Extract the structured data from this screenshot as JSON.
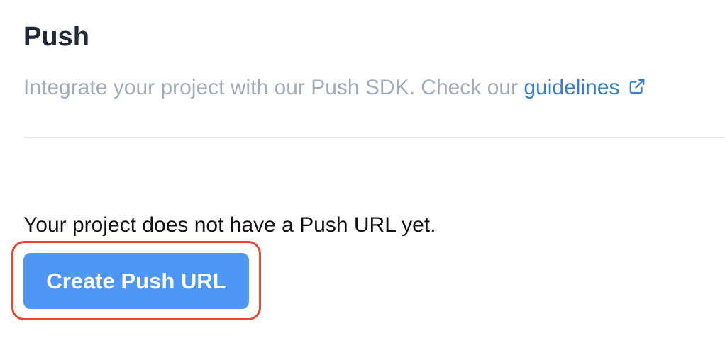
{
  "section": {
    "title": "Push",
    "description_prefix": "Integrate your project with our Push SDK. Check our ",
    "link_label": "guidelines",
    "link_icon": "external-link-icon",
    "link_color": "#3b7fc6"
  },
  "empty_state": {
    "message": "Your project does not have a Push URL yet.",
    "button_label": "Create Push URL",
    "button_color": "#4f97f5",
    "highlight_color": "#e5492f"
  }
}
